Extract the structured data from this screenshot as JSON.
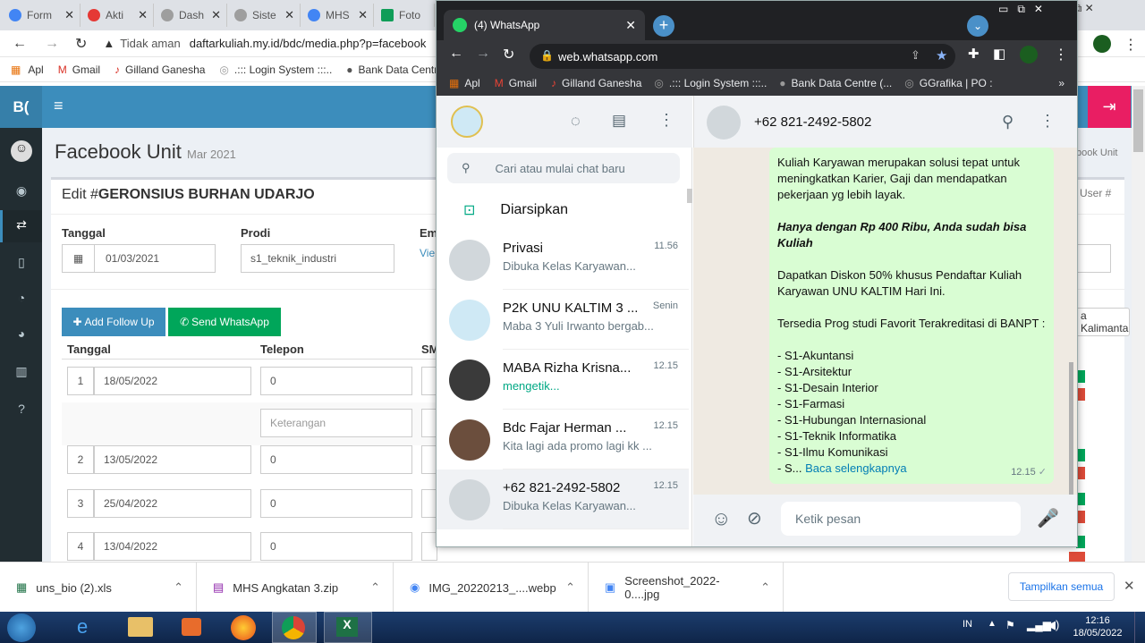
{
  "bg_browser": {
    "tabs": [
      {
        "label": "Form",
        "color": "#4285f4"
      },
      {
        "label": "Akti",
        "color": "#e53935"
      },
      {
        "label": "Dash",
        "color": "#9e9e9e"
      },
      {
        "label": "Siste",
        "color": "#9e9e9e"
      },
      {
        "label": "MHS",
        "color": "#4285f4"
      },
      {
        "label": "Foto",
        "color": "#0f9d58"
      }
    ],
    "security": "Tidak aman",
    "url": "daftarkuliah.my.id/bdc/media.php?p=facebook",
    "bookmarks": [
      "Apl",
      "Gmail",
      "Gilland Ganesha",
      ".::: Login System :::..",
      "Bank Data Centr"
    ]
  },
  "admin": {
    "logo": "B(",
    "page_title": "Facebook Unit",
    "page_subtitle": "Mar 2021",
    "breadcrumb": "book Unit",
    "edit_prefix": "Edit #",
    "edit_name": "GERONSIUS BURHAN UDARJO",
    "user_label": "User #",
    "fields": {
      "tanggal_label": "Tanggal",
      "tanggal_value": "01/03/2021",
      "prodi_label": "Prodi",
      "prodi_value": "s1_teknik_industri",
      "em_label": "Em",
      "view_link": "Vie"
    },
    "right_value": "a Kalimanta",
    "buttons": {
      "add_follow_up": "Add Follow Up",
      "send_whatsapp": "Send WhatsApp"
    },
    "table_headers": {
      "tanggal": "Tanggal",
      "telepon": "Telepon",
      "sm": "SM"
    },
    "rows": [
      {
        "no": "1",
        "date": "18/05/2022",
        "phone": "0"
      },
      {
        "no": "2",
        "date": "13/05/2022",
        "phone": "0"
      },
      {
        "no": "3",
        "date": "25/04/2022",
        "phone": "0"
      },
      {
        "no": "4",
        "date": "13/04/2022",
        "phone": "0"
      }
    ],
    "keterangan_placeholder": "Keterangan"
  },
  "wa": {
    "tab_title": "(4) WhatsApp",
    "url": "web.whatsapp.com",
    "bookmarks": [
      "Apl",
      "Gmail",
      "Gilland Ganesha",
      ".::: Login System :::..",
      "Bank Data Centre (...",
      "GGrafika | PO :"
    ],
    "search_placeholder": "Cari atau mulai chat baru",
    "archived": "Diarsipkan",
    "chats": [
      {
        "name": "Privasi",
        "time": "11.56",
        "msg": "Dibuka Kelas Karyawan...",
        "avatar": "#d1d7db"
      },
      {
        "name": "P2K UNU KALTIM 3 ...",
        "time": "Senin",
        "msg": "Maba 3 Yuli Irwanto bergab...",
        "avatar": "#cfe9f5"
      },
      {
        "name": "MABA Rizha Krisna...",
        "time": "12.15",
        "msg": "mengetik...",
        "avatar": "#3a3a3a"
      },
      {
        "name": "Bdc Fajar Herman ...",
        "time": "12.15",
        "msg": "Kita lagi ada promo lagi kk ...",
        "avatar": "#6b4e3d"
      },
      {
        "name": "+62 821-2492-5802",
        "time": "12.15",
        "msg": "Dibuka Kelas Karyawan...",
        "avatar": "#d1d7db"
      }
    ],
    "contact": "+62 821-2492-5802",
    "message_lines": [
      "Kuliah Karyawan merupakan solusi tepat untuk",
      "meningkatkan Karier, Gaji dan mendapatkan",
      "pekerjaan yg lebih layak.",
      "",
      "Hanya dengan Rp 400 Ribu, Anda sudah bisa",
      "Kuliah",
      "",
      "Dapatkan Diskon 50% khusus Pendaftar Kuliah",
      "Karyawan UNU KALTIM Hari Ini.",
      "",
      "Tersedia Prog studi Favorit Terakreditasi di BANPT :",
      "",
      "- S1-Akuntansi",
      "- S1-Arsitektur",
      "- S1-Desain Interior",
      "- S1-Farmasi",
      "- S1-Hubungan Internasional",
      "- S1-Teknik Informatika",
      "- S1-Ilmu Komunikasi"
    ],
    "last_line_prefix": "- S...",
    "read_more": "Baca selengkapnya",
    "msg_time": "12.15",
    "input_placeholder": "Ketik pesan"
  },
  "downloads": {
    "items": [
      "uns_bio (2).xls",
      "MHS Angkatan 3.zip",
      "IMG_20220213_....webp",
      "Screenshot_2022-0....jpg"
    ],
    "show_all": "Tampilkan semua"
  },
  "taskbar": {
    "lang": "IN",
    "time": "12:16",
    "date": "18/05/2022"
  }
}
